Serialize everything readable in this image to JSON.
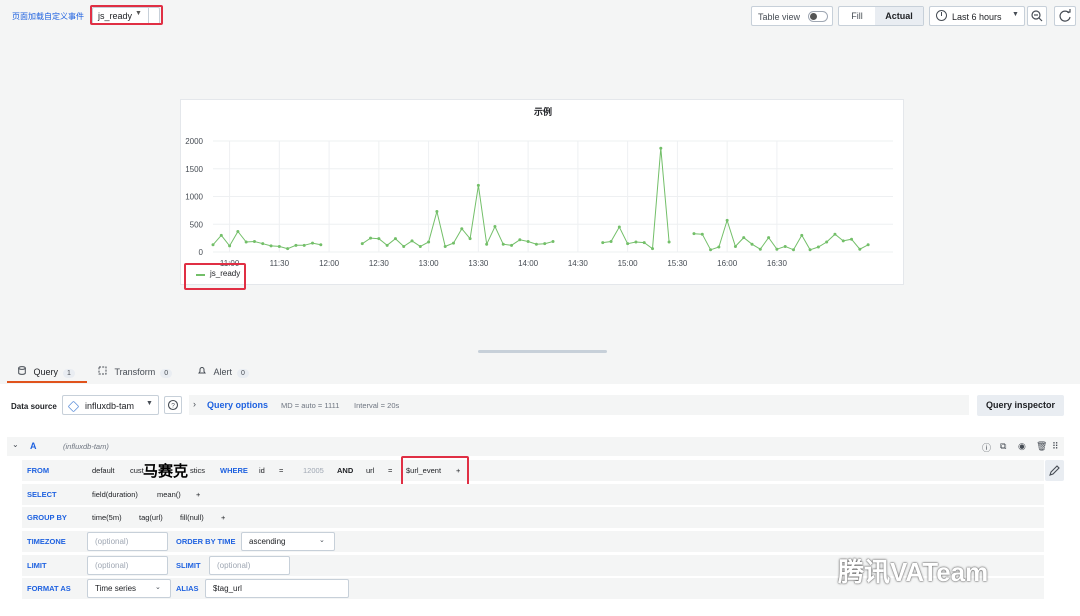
{
  "dashboard": {
    "link_title": "页面加载自定义事件",
    "variable_value": "js_ready",
    "table_view_label": "Table view",
    "fill_label": "Fill",
    "actual_label": "Actual",
    "time_range": "Last 6 hours"
  },
  "panel": {
    "title": "示例"
  },
  "chart_data": {
    "type": "line",
    "title": "示例",
    "xlabel": "",
    "ylabel": "",
    "ylim": [
      0,
      2000
    ],
    "y_ticks": [
      "0",
      "500",
      "1000",
      "1500",
      "2000"
    ],
    "x_ticks": [
      "11:00",
      "11:30",
      "12:00",
      "12:30",
      "13:00",
      "13:30",
      "14:00",
      "14:30",
      "15:00",
      "15:30",
      "16:00",
      "16:30"
    ],
    "grid": true,
    "legend": "bottom-left",
    "series": [
      {
        "name": "js_ready",
        "color": "#73bf69",
        "x_minutes_from_10_50": [
          0,
          5,
          10,
          15,
          20,
          25,
          30,
          35,
          40,
          45,
          50,
          55,
          60,
          65,
          70,
          75,
          80,
          90,
          95,
          100,
          105,
          110,
          115,
          120,
          125,
          130,
          135,
          140,
          145,
          150,
          155,
          160,
          165,
          170,
          175,
          180,
          185,
          190,
          195,
          200,
          205,
          210,
          215,
          220,
          225,
          235,
          240,
          245,
          250,
          255,
          260,
          265,
          270,
          275,
          280,
          290,
          295,
          300,
          305,
          310,
          315,
          320,
          325,
          330,
          335,
          340,
          345,
          350,
          355,
          360,
          365,
          370,
          375,
          380,
          385,
          390,
          395,
          400,
          405,
          410
        ],
        "values": [
          130,
          300,
          110,
          370,
          180,
          190,
          150,
          110,
          100,
          60,
          120,
          120,
          160,
          130,
          null,
          null,
          null,
          150,
          250,
          240,
          120,
          240,
          100,
          200,
          100,
          180,
          730,
          100,
          160,
          420,
          240,
          1200,
          140,
          460,
          140,
          120,
          220,
          190,
          140,
          150,
          190,
          null,
          null,
          null,
          null,
          170,
          190,
          450,
          150,
          180,
          170,
          60,
          1870,
          180,
          null,
          330,
          320,
          40,
          90,
          570,
          100,
          260,
          140,
          50,
          260,
          50,
          100,
          40,
          300,
          40,
          90,
          180,
          320,
          200,
          230,
          50,
          130,
          null,
          null,
          null
        ],
        "x_labels_note": ""
      }
    ]
  },
  "legend": {
    "series_name": "js_ready"
  },
  "tabs": [
    {
      "label": "Query",
      "count": "1"
    },
    {
      "label": "Transform",
      "count": "0"
    },
    {
      "label": "Alert",
      "count": "0"
    }
  ],
  "editor": {
    "datasource_label": "Data source",
    "datasource": "influxdb-tam",
    "query_options_label": "Query options",
    "md": "MD = auto = 1111",
    "interval": "Interval = 20s",
    "query_inspector": "Query inspector",
    "query_name": "A",
    "query_source": "(influxdb-tam)",
    "from": {
      "kw": "FROM",
      "policy": "default",
      "measurement": "cust",
      "measurement_tail": "stics",
      "where_kw": "WHERE",
      "tag1": "id",
      "op1": "=",
      "val1": "12005",
      "and_kw": "AND",
      "tag2": "url",
      "op2": "=",
      "val2": "$url_event",
      "plus": "+"
    },
    "select": {
      "kw": "SELECT",
      "field": "field(duration)",
      "fn": "mean()",
      "plus": "+"
    },
    "group_by": {
      "kw": "GROUP BY",
      "time": "time(5m)",
      "tag": "tag(url)",
      "fill": "fill(null)",
      "plus": "+"
    },
    "timezone": {
      "kw": "TIMEZONE",
      "placeholder": "(optional)",
      "order_kw": "ORDER BY TIME",
      "order": "ascending"
    },
    "limit": {
      "kw": "LIMIT",
      "placeholder": "(optional)",
      "slimit_kw": "SLIMIT",
      "slimit_placeholder": "(optional)"
    },
    "format": {
      "kw": "FORMAT AS",
      "value": "Time series",
      "alias_kw": "ALIAS",
      "alias": "$tag_url"
    }
  },
  "overlay_text": "马赛克",
  "watermark": "腾讯VATeam"
}
